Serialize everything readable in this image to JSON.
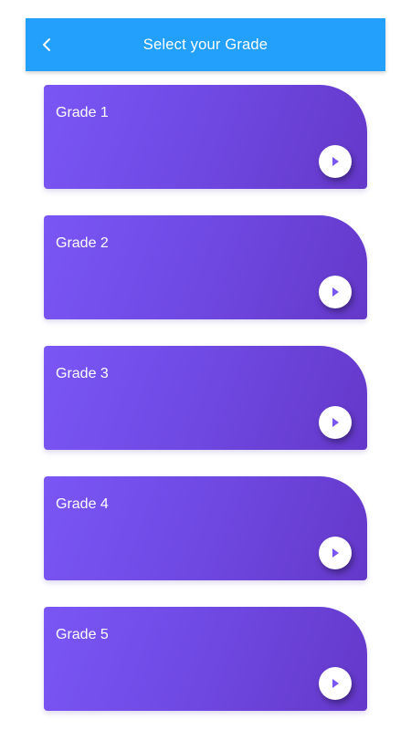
{
  "header": {
    "title": "Select your Grade",
    "back_icon": "chevron-left-icon",
    "background_color": "#22a0fb"
  },
  "grades": [
    {
      "label": "Grade 1",
      "action_icon": "play-arrow-icon"
    },
    {
      "label": "Grade 2",
      "action_icon": "play-arrow-icon"
    },
    {
      "label": "Grade 3",
      "action_icon": "play-arrow-icon"
    },
    {
      "label": "Grade 4",
      "action_icon": "play-arrow-icon"
    },
    {
      "label": "Grade 5",
      "action_icon": "play-arrow-icon"
    }
  ],
  "colors": {
    "card_gradient_start": "#7a56f5",
    "card_gradient_end": "#6438c9",
    "play_icon": "#7a56f5"
  }
}
